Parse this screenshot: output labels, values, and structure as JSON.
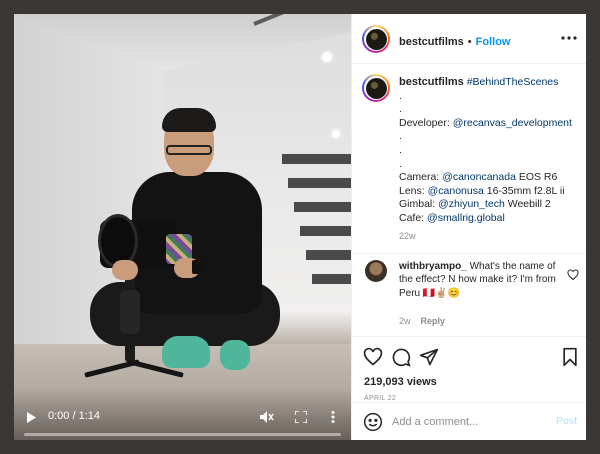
{
  "video": {
    "time_display": "0:00 / 1:14",
    "progress_fraction": 0.0
  },
  "header": {
    "username": "bestcutfilms",
    "separator": "•",
    "follow_label": "Follow",
    "more_icon": "more-horizontal-icon"
  },
  "caption": {
    "username": "bestcutfilms",
    "hashtag": "#BehindTheScenes",
    "dot1": ".",
    "dot2": ".",
    "developer_label": "Developer:",
    "developer_handle": "@recanvas_development",
    "dot3": ".",
    "dot4": ".",
    "dot5": ".",
    "camera_label": "Camera:",
    "camera_handle": "@canoncanada",
    "camera_model": "EOS R6",
    "lens_label": "Lens:",
    "lens_handle": "@canonusa",
    "lens_model": "16-35mm f2.8L ii",
    "gimbal_label": "Gimbal:",
    "gimbal_handle": "@zhiyun_tech",
    "gimbal_model": "Weebill 2",
    "cafe_label": "Cafe:",
    "cafe_handle": "@smallrig.global",
    "age": "22w"
  },
  "comment": {
    "username": "withbryampo_",
    "text": "What's the name of the effect? N how make it? I'm from Peru 🇵🇪✌🏼😊",
    "age": "2w",
    "reply_label": "Reply"
  },
  "stats": {
    "views": "219,093 views",
    "date": "APRIL 22"
  },
  "add_comment": {
    "placeholder": "Add a comment...",
    "post_label": "Post"
  },
  "colors": {
    "accent": "#0095f6",
    "link": "#00376b",
    "muted": "#8e8e8e",
    "post_disabled": "#b2dffc",
    "sock": "#4fb59b"
  }
}
